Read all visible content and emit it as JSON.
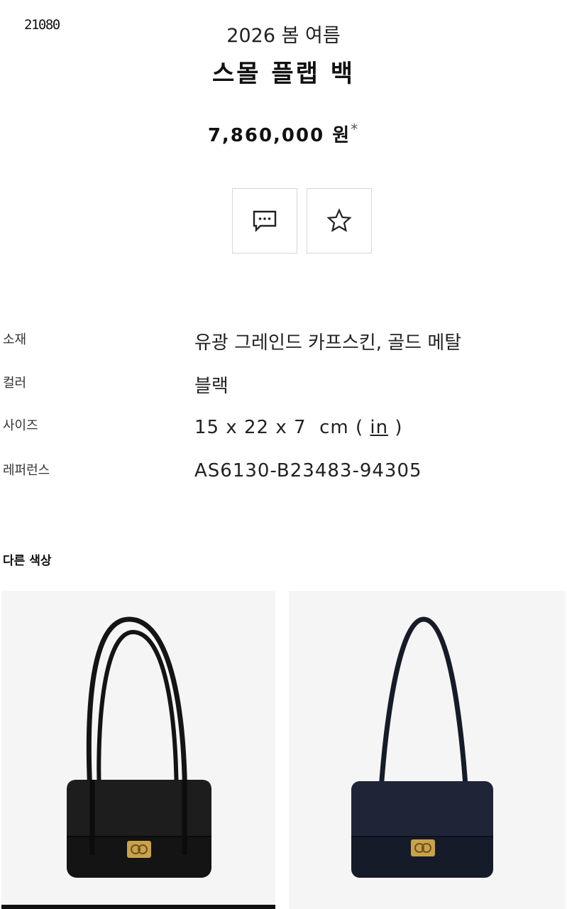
{
  "code_label": "21080",
  "product": {
    "season": "2026 봄 여름",
    "name": "스몰 플랩 백",
    "price": "7,860,000 원",
    "price_asterisk": "*"
  },
  "actions": {
    "contact_icon": "chat-bubble-icon",
    "wishlist_icon": "star-outline-icon"
  },
  "specs": [
    {
      "label": "소재",
      "value": "유광 그레인드 카프스킨, 골드 메탈"
    },
    {
      "label": "컬러",
      "value": "블랙"
    },
    {
      "label": "사이즈",
      "value_main": "15 x 22 x 7  cm",
      "value_open": "( ",
      "unit_link": "in",
      "value_close": " )"
    },
    {
      "label": "레퍼런스",
      "value": "AS6130-B23483-94305"
    }
  ],
  "other_colors": {
    "title": "다른 색상",
    "items": [
      {
        "bag_color": "#141414",
        "hardware_color": "#c9a24a"
      },
      {
        "bag_color": "#161b29",
        "hardware_color": "#c9a24a"
      }
    ]
  },
  "colors": {
    "card_bg": "#f5f5f5",
    "border": "#d6d6d6",
    "text": "#111111"
  }
}
